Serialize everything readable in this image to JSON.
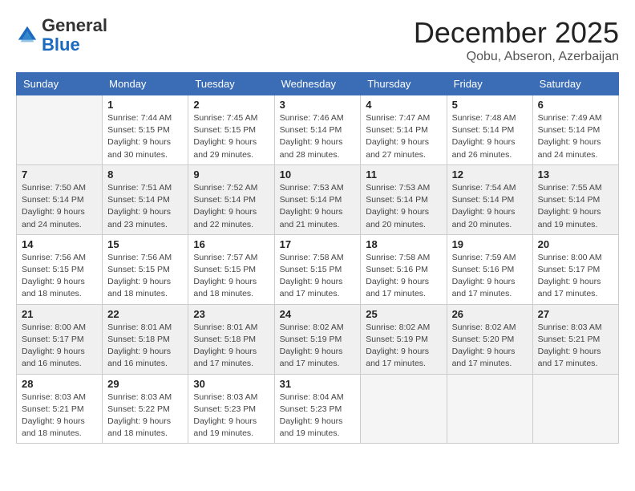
{
  "logo": {
    "general": "General",
    "blue": "Blue"
  },
  "header": {
    "month": "December 2025",
    "location": "Qobu, Abseron, Azerbaijan"
  },
  "weekdays": [
    "Sunday",
    "Monday",
    "Tuesday",
    "Wednesday",
    "Thursday",
    "Friday",
    "Saturday"
  ],
  "weeks": [
    [
      {
        "num": "",
        "info": ""
      },
      {
        "num": "1",
        "info": "Sunrise: 7:44 AM\nSunset: 5:15 PM\nDaylight: 9 hours\nand 30 minutes."
      },
      {
        "num": "2",
        "info": "Sunrise: 7:45 AM\nSunset: 5:15 PM\nDaylight: 9 hours\nand 29 minutes."
      },
      {
        "num": "3",
        "info": "Sunrise: 7:46 AM\nSunset: 5:14 PM\nDaylight: 9 hours\nand 28 minutes."
      },
      {
        "num": "4",
        "info": "Sunrise: 7:47 AM\nSunset: 5:14 PM\nDaylight: 9 hours\nand 27 minutes."
      },
      {
        "num": "5",
        "info": "Sunrise: 7:48 AM\nSunset: 5:14 PM\nDaylight: 9 hours\nand 26 minutes."
      },
      {
        "num": "6",
        "info": "Sunrise: 7:49 AM\nSunset: 5:14 PM\nDaylight: 9 hours\nand 24 minutes."
      }
    ],
    [
      {
        "num": "7",
        "info": "Sunrise: 7:50 AM\nSunset: 5:14 PM\nDaylight: 9 hours\nand 24 minutes."
      },
      {
        "num": "8",
        "info": "Sunrise: 7:51 AM\nSunset: 5:14 PM\nDaylight: 9 hours\nand 23 minutes."
      },
      {
        "num": "9",
        "info": "Sunrise: 7:52 AM\nSunset: 5:14 PM\nDaylight: 9 hours\nand 22 minutes."
      },
      {
        "num": "10",
        "info": "Sunrise: 7:53 AM\nSunset: 5:14 PM\nDaylight: 9 hours\nand 21 minutes."
      },
      {
        "num": "11",
        "info": "Sunrise: 7:53 AM\nSunset: 5:14 PM\nDaylight: 9 hours\nand 20 minutes."
      },
      {
        "num": "12",
        "info": "Sunrise: 7:54 AM\nSunset: 5:14 PM\nDaylight: 9 hours\nand 20 minutes."
      },
      {
        "num": "13",
        "info": "Sunrise: 7:55 AM\nSunset: 5:14 PM\nDaylight: 9 hours\nand 19 minutes."
      }
    ],
    [
      {
        "num": "14",
        "info": "Sunrise: 7:56 AM\nSunset: 5:15 PM\nDaylight: 9 hours\nand 18 minutes."
      },
      {
        "num": "15",
        "info": "Sunrise: 7:56 AM\nSunset: 5:15 PM\nDaylight: 9 hours\nand 18 minutes."
      },
      {
        "num": "16",
        "info": "Sunrise: 7:57 AM\nSunset: 5:15 PM\nDaylight: 9 hours\nand 18 minutes."
      },
      {
        "num": "17",
        "info": "Sunrise: 7:58 AM\nSunset: 5:15 PM\nDaylight: 9 hours\nand 17 minutes."
      },
      {
        "num": "18",
        "info": "Sunrise: 7:58 AM\nSunset: 5:16 PM\nDaylight: 9 hours\nand 17 minutes."
      },
      {
        "num": "19",
        "info": "Sunrise: 7:59 AM\nSunset: 5:16 PM\nDaylight: 9 hours\nand 17 minutes."
      },
      {
        "num": "20",
        "info": "Sunrise: 8:00 AM\nSunset: 5:17 PM\nDaylight: 9 hours\nand 17 minutes."
      }
    ],
    [
      {
        "num": "21",
        "info": "Sunrise: 8:00 AM\nSunset: 5:17 PM\nDaylight: 9 hours\nand 16 minutes."
      },
      {
        "num": "22",
        "info": "Sunrise: 8:01 AM\nSunset: 5:18 PM\nDaylight: 9 hours\nand 16 minutes."
      },
      {
        "num": "23",
        "info": "Sunrise: 8:01 AM\nSunset: 5:18 PM\nDaylight: 9 hours\nand 17 minutes."
      },
      {
        "num": "24",
        "info": "Sunrise: 8:02 AM\nSunset: 5:19 PM\nDaylight: 9 hours\nand 17 minutes."
      },
      {
        "num": "25",
        "info": "Sunrise: 8:02 AM\nSunset: 5:19 PM\nDaylight: 9 hours\nand 17 minutes."
      },
      {
        "num": "26",
        "info": "Sunrise: 8:02 AM\nSunset: 5:20 PM\nDaylight: 9 hours\nand 17 minutes."
      },
      {
        "num": "27",
        "info": "Sunrise: 8:03 AM\nSunset: 5:21 PM\nDaylight: 9 hours\nand 17 minutes."
      }
    ],
    [
      {
        "num": "28",
        "info": "Sunrise: 8:03 AM\nSunset: 5:21 PM\nDaylight: 9 hours\nand 18 minutes."
      },
      {
        "num": "29",
        "info": "Sunrise: 8:03 AM\nSunset: 5:22 PM\nDaylight: 9 hours\nand 18 minutes."
      },
      {
        "num": "30",
        "info": "Sunrise: 8:03 AM\nSunset: 5:23 PM\nDaylight: 9 hours\nand 19 minutes."
      },
      {
        "num": "31",
        "info": "Sunrise: 8:04 AM\nSunset: 5:23 PM\nDaylight: 9 hours\nand 19 minutes."
      },
      {
        "num": "",
        "info": ""
      },
      {
        "num": "",
        "info": ""
      },
      {
        "num": "",
        "info": ""
      }
    ]
  ]
}
